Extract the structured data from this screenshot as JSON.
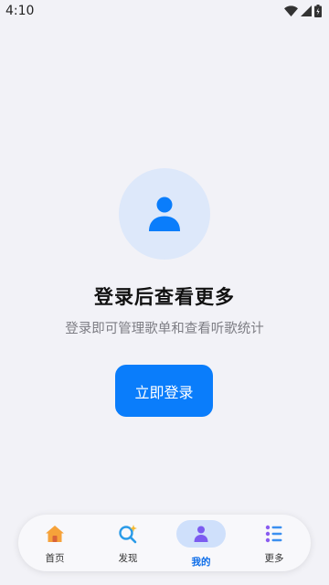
{
  "status_bar": {
    "time": "4:10"
  },
  "content": {
    "title": "登录后查看更多",
    "subtitle": "登录即可管理歌单和查看听歌统计",
    "login_button_label": "立即登录"
  },
  "tab_bar": {
    "active_index": 2,
    "items": [
      {
        "label": "首页",
        "icon": "home-icon"
      },
      {
        "label": "发现",
        "icon": "discover-icon"
      },
      {
        "label": "我的",
        "icon": "profile-icon"
      },
      {
        "label": "更多",
        "icon": "more-icon"
      }
    ]
  },
  "colors": {
    "accent": "#0a7dfb",
    "avatar_bg": "#dde8fa",
    "page_bg": "#f2f2f7"
  }
}
